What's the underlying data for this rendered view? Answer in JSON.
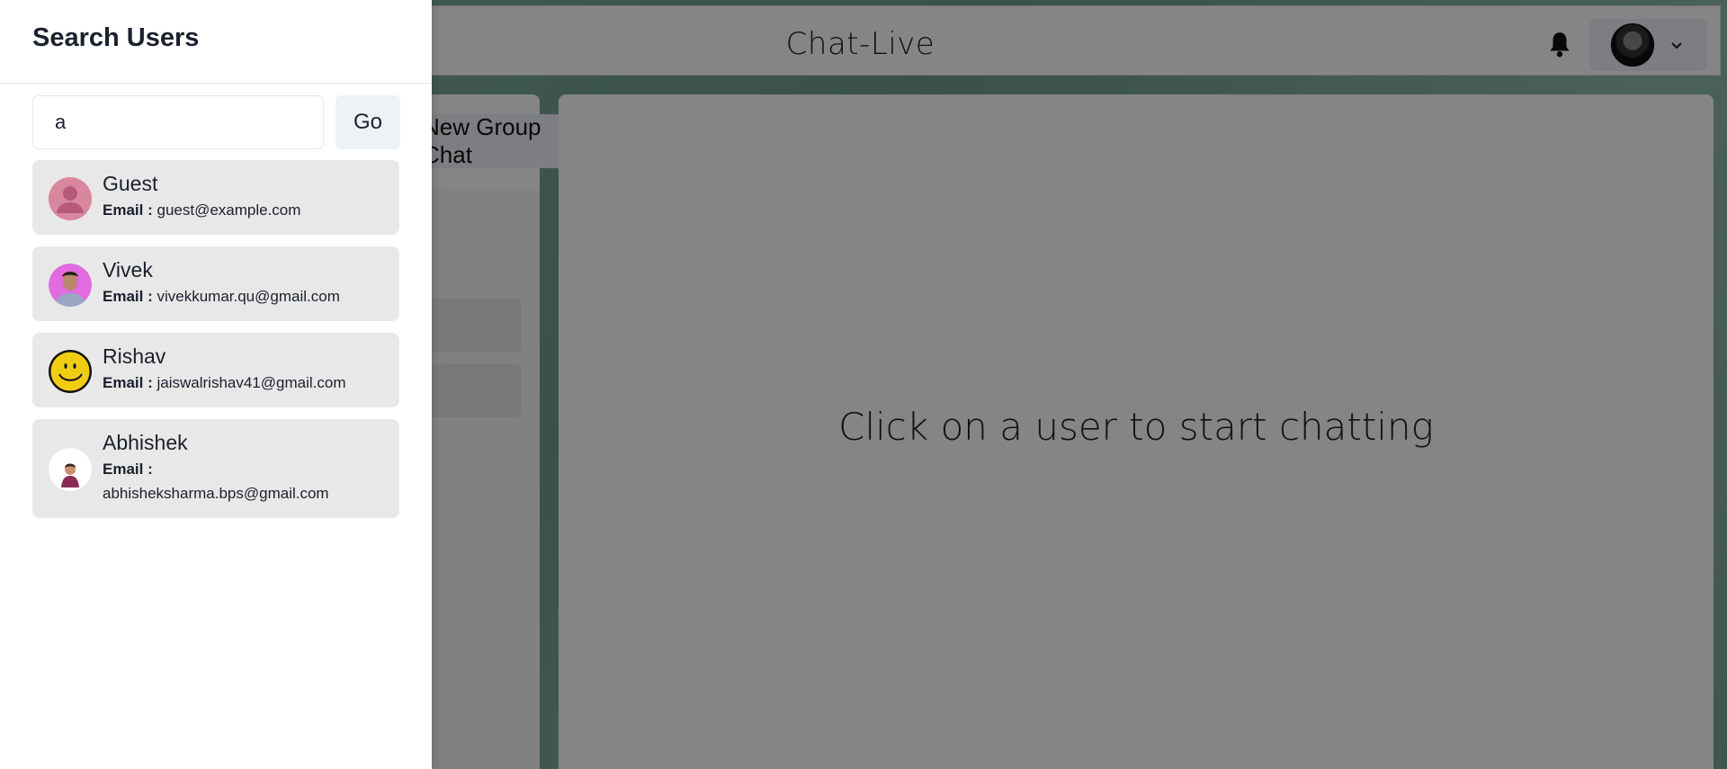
{
  "app": {
    "title": "Chat-Live",
    "new_chat_label": "New Group Chat",
    "empty_message": "Click on a user to start chatting"
  },
  "icons": {
    "bell": "bell-icon",
    "chevron": "chevron-down-icon",
    "plus": "plus-icon"
  },
  "drawer": {
    "title": "Search Users",
    "search_value": "a",
    "go_label": "Go",
    "email_label": "Email :"
  },
  "users": [
    {
      "name": "Guest",
      "email": "guest@example.com",
      "avatar": "default-person"
    },
    {
      "name": "Vivek",
      "email": "vivekkumar.qu@gmail.com",
      "avatar": "photo"
    },
    {
      "name": "Rishav",
      "email": "jaiswalrishav41@gmail.com",
      "avatar": "smiley"
    },
    {
      "name": "Abhishek",
      "email": "abhisheksharma.bps@gmail.com",
      "avatar": "photo"
    }
  ],
  "colors": {
    "drawer_bg": "#ffffff",
    "card_bg": "#e8e8e8",
    "button_bg": "#edf2f7",
    "overlay": "rgba(0,0,0,0.48)"
  }
}
